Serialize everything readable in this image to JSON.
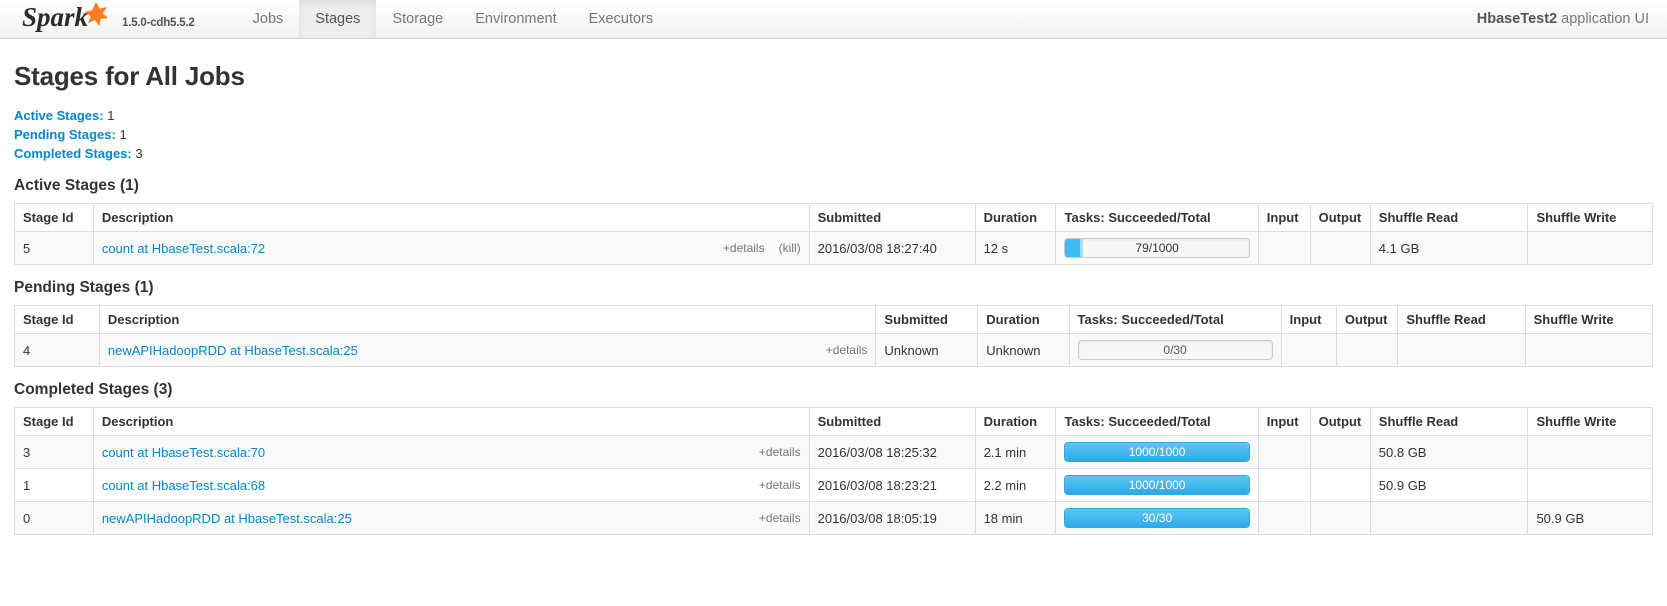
{
  "navbar": {
    "brand": "Spark",
    "version": "1.5.0-cdh5.5.2",
    "links": [
      {
        "label": "Jobs",
        "active": false
      },
      {
        "label": "Stages",
        "active": true
      },
      {
        "label": "Storage",
        "active": false
      },
      {
        "label": "Environment",
        "active": false
      },
      {
        "label": "Executors",
        "active": false
      }
    ],
    "app_name": "HbaseTest2",
    "app_suffix": "application UI"
  },
  "page": {
    "title": "Stages for All Jobs",
    "summary": [
      {
        "label": "Active Stages:",
        "value": "1"
      },
      {
        "label": "Pending Stages:",
        "value": "1"
      },
      {
        "label": "Completed Stages:",
        "value": "3"
      }
    ]
  },
  "columns": {
    "stage_id": "Stage Id",
    "description": "Description",
    "submitted": "Submitted",
    "duration": "Duration",
    "tasks": "Tasks: Succeeded/Total",
    "input": "Input",
    "output": "Output",
    "shuffle_read": "Shuffle Read",
    "shuffle_write": "Shuffle Write"
  },
  "labels": {
    "details": "+details",
    "kill": "(kill)"
  },
  "colors": {
    "link": "#0088cc",
    "progress_completed": "#2fa8e8",
    "progress_running": "#a4e0fb",
    "brand_accent": "#ff7b1c"
  },
  "active_stages": {
    "heading": "Active Stages (1)",
    "rows": [
      {
        "stage_id": "5",
        "description": "count at HbaseTest.scala:72",
        "details": "+details",
        "kill": "(kill)",
        "submitted": "2016/03/08 18:27:40",
        "duration": "12 s",
        "tasks_label": "79/1000",
        "tasks_completed": 79,
        "tasks_total": 1000,
        "tasks_running": 16,
        "input": "",
        "output": "",
        "shuffle_read": "4.1 GB",
        "shuffle_write": ""
      }
    ]
  },
  "pending_stages": {
    "heading": "Pending Stages (1)",
    "rows": [
      {
        "stage_id": "4",
        "description": "newAPIHadoopRDD at HbaseTest.scala:25",
        "details": "+details",
        "submitted": "Unknown",
        "duration": "Unknown",
        "tasks_label": "0/30",
        "tasks_completed": 0,
        "tasks_total": 30,
        "tasks_running": 0,
        "input": "",
        "output": "",
        "shuffle_read": "",
        "shuffle_write": ""
      }
    ]
  },
  "completed_stages": {
    "heading": "Completed Stages (3)",
    "rows": [
      {
        "stage_id": "3",
        "description": "count at HbaseTest.scala:70",
        "details": "+details",
        "submitted": "2016/03/08 18:25:32",
        "duration": "2.1 min",
        "tasks_label": "1000/1000",
        "tasks_completed": 1000,
        "tasks_total": 1000,
        "tasks_running": 0,
        "input": "",
        "output": "",
        "shuffle_read": "50.8 GB",
        "shuffle_write": ""
      },
      {
        "stage_id": "1",
        "description": "count at HbaseTest.scala:68",
        "details": "+details",
        "submitted": "2016/03/08 18:23:21",
        "duration": "2.2 min",
        "tasks_label": "1000/1000",
        "tasks_completed": 1000,
        "tasks_total": 1000,
        "tasks_running": 0,
        "input": "",
        "output": "",
        "shuffle_read": "50.9 GB",
        "shuffle_write": ""
      },
      {
        "stage_id": "0",
        "description": "newAPIHadoopRDD at HbaseTest.scala:25",
        "details": "+details",
        "submitted": "2016/03/08 18:05:19",
        "duration": "18 min",
        "tasks_label": "30/30",
        "tasks_completed": 30,
        "tasks_total": 30,
        "tasks_running": 0,
        "input": "",
        "output": "",
        "shuffle_read": "",
        "shuffle_write": "50.9 GB"
      }
    ]
  }
}
